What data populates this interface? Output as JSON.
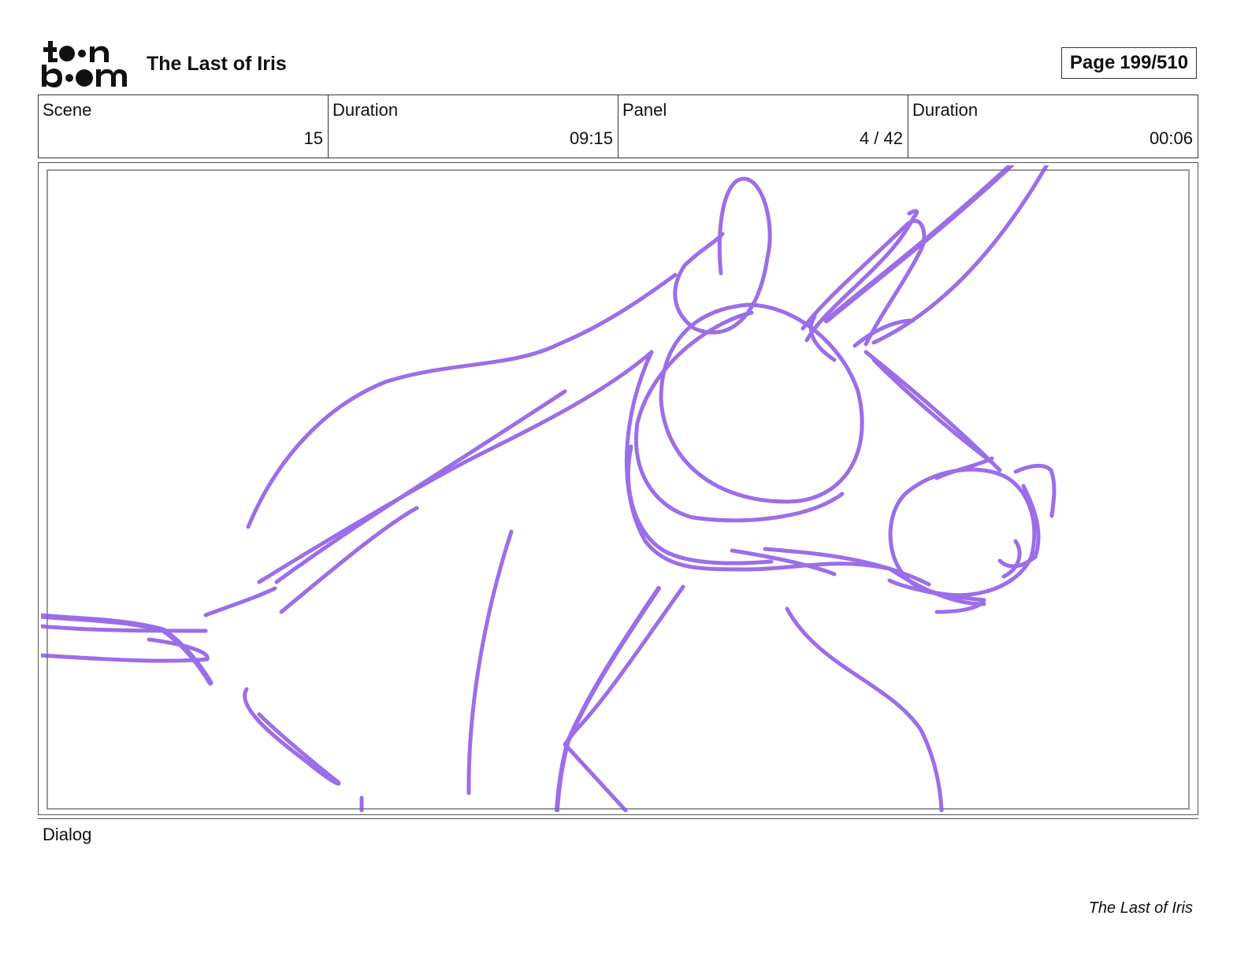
{
  "header": {
    "logo_icon": "toonboom-logo",
    "project_title": "The Last of Iris",
    "page_label": "Page",
    "page_value": "199/510"
  },
  "info": {
    "scene_label": "Scene",
    "scene_value": "15",
    "scene_duration_label": "Duration",
    "scene_duration_value": "09:15",
    "panel_label": "Panel",
    "panel_value": "4 / 42",
    "panel_duration_label": "Duration",
    "panel_duration_value": "00:06"
  },
  "panel": {
    "sketch_icon": "horse-head-sketch",
    "stroke_color": "#8a55e6"
  },
  "dialog": {
    "label": "Dialog"
  },
  "footer": {
    "text": "The Last of Iris"
  }
}
